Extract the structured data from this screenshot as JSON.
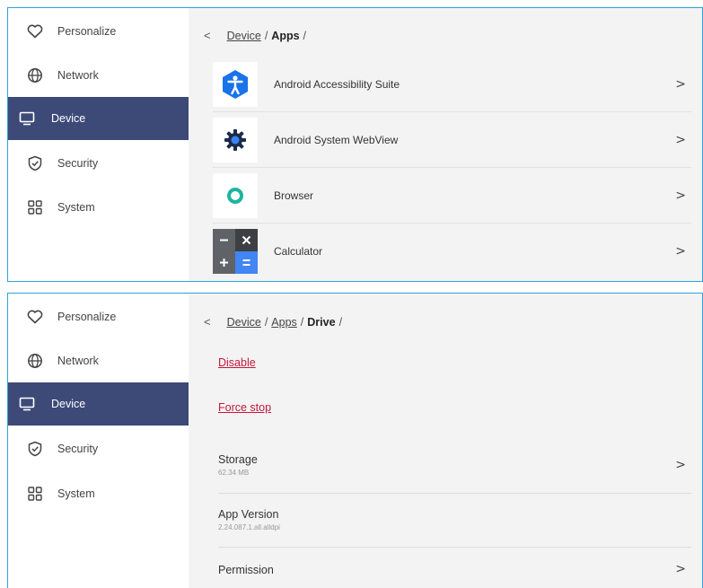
{
  "nav": {
    "items": [
      {
        "id": "personalize",
        "label": "Personalize",
        "icon": "heart-icon"
      },
      {
        "id": "network",
        "label": "Network",
        "icon": "globe-icon"
      },
      {
        "id": "device",
        "label": "Device",
        "icon": "monitor-icon"
      },
      {
        "id": "security",
        "label": "Security",
        "icon": "shield-check-icon"
      },
      {
        "id": "system",
        "label": "System",
        "icon": "grid-icon"
      }
    ],
    "active": "device",
    "active_color": "#3d4a78"
  },
  "top": {
    "breadcrumb": {
      "back": "<",
      "link1": "Device",
      "sep1": "/",
      "current": "Apps",
      "sep2": "/"
    },
    "apps": [
      {
        "name": "Android Accessibility Suite",
        "icon": "accessibility-icon",
        "chevron": ">"
      },
      {
        "name": "Android System WebView",
        "icon": "gear-icon",
        "chevron": ">"
      },
      {
        "name": "Browser",
        "icon": "browser-ring-icon",
        "chevron": ">"
      },
      {
        "name": "Calculator",
        "icon": "calculator-icon",
        "chevron": ">"
      }
    ]
  },
  "bottom": {
    "breadcrumb": {
      "back": "<",
      "link1": "Device",
      "sep1": "/",
      "link2": "Apps",
      "sep2": "/",
      "current": "Drive",
      "sep3": "/"
    },
    "actions": {
      "disable": "Disable",
      "force_stop": "Force stop"
    },
    "storage": {
      "title": "Storage",
      "value": "62.34 MB",
      "chevron": ">"
    },
    "app_version": {
      "title": "App Version",
      "value": "2.24.087.1.all.alldpi"
    },
    "permission": {
      "title": "Permission",
      "chevron": ">"
    }
  },
  "colors": {
    "accent_link": "#c4183c",
    "border": "#2ea3d4"
  }
}
